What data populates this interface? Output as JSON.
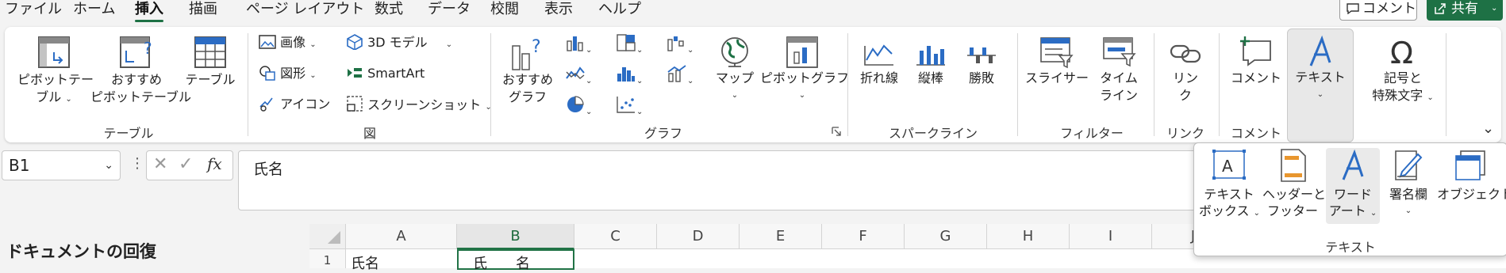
{
  "menu": {
    "tabs": [
      "ファイル",
      "ホーム",
      "挿入",
      "描画",
      "ページ レイアウト",
      "数式",
      "データ",
      "校閲",
      "表示",
      "ヘルプ"
    ],
    "active": "挿入",
    "comment_button": "コメント",
    "share_button": "共有"
  },
  "ribbon": {
    "table_group": {
      "pivot_table": [
        "ピボットテー",
        "ブル"
      ],
      "recommended_pivot": [
        "おすすめ",
        "ピボットテーブル"
      ],
      "table": "テーブル",
      "label": "テーブル"
    },
    "illustrations_group": {
      "image": "画像",
      "shapes": "図形",
      "icons": "アイコン",
      "model3d": "3D モデル",
      "smartart": "SmartArt",
      "screenshot": "スクリーンショット",
      "label": "図"
    },
    "charts_group": {
      "recommended": [
        "おすすめ",
        "グラフ"
      ],
      "maps": "マップ",
      "pivot_chart": "ピボットグラフ",
      "label": "グラフ"
    },
    "sparklines_group": {
      "line": "折れ線",
      "column": "縦棒",
      "winloss": "勝敗",
      "label": "スパークライン"
    },
    "filters_group": {
      "slicer": "スライサー",
      "timeline": [
        "タイム",
        "ライン"
      ],
      "label": "フィルター"
    },
    "links_group": {
      "link": [
        "リン",
        "ク"
      ],
      "label": "リンク"
    },
    "comments_group": {
      "comment": "コメント",
      "label": "コメント"
    },
    "text_group": {
      "text": "テキスト"
    },
    "symbols_group": {
      "symbols": [
        "記号と",
        "特殊文字"
      ]
    }
  },
  "formula_bar": {
    "name_box": "B1",
    "fx": "fx",
    "content": "氏名"
  },
  "recovery_title": "ドキュメントの回復",
  "grid": {
    "columns": [
      "A",
      "B",
      "C",
      "D",
      "E",
      "F",
      "G",
      "H",
      "I",
      "J"
    ],
    "row1": "1",
    "a1": "氏名",
    "b1": "氏　　名"
  },
  "text_popup": {
    "textbox": [
      "テキスト",
      "ボックス"
    ],
    "header_footer": [
      "ヘッダーと",
      "フッター"
    ],
    "wordart": [
      "ワード",
      "アート"
    ],
    "signature": "署名欄",
    "object": "オブジェクト",
    "label": "テキスト"
  },
  "colors": {
    "accent_green": "#1e7145",
    "icon_blue": "#2b6cc4",
    "icon_orange": "#e8962e"
  }
}
